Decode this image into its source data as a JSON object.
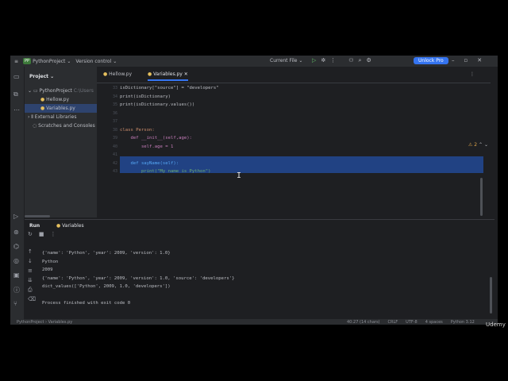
{
  "titlebar": {
    "project_name": "PythonProject",
    "project_badge": "PP",
    "vcs": "Version control",
    "run_config": "Current File",
    "unlock": "Unlock Pro"
  },
  "project_panel": {
    "header": "Project",
    "root": "PythonProject",
    "root_path": "C:\\Users",
    "files": [
      "Hellow.py",
      "Variables.py"
    ],
    "external": "External Libraries",
    "scratches": "Scratches and Consoles"
  },
  "editor": {
    "tabs": [
      "Hellow.py",
      "Variables.py"
    ],
    "warnings": "⚠ 2",
    "line_numbers": [
      "33",
      "34",
      "35",
      "36",
      "37",
      "38",
      "39",
      "40",
      "41",
      "42",
      "43"
    ],
    "lines": [
      "isDictionary[\"source\"] = \"developers\"",
      "print(isDictionary)",
      "print(isDictionary.values())",
      "",
      "",
      "class Person:",
      "    def __init__(self,age):",
      "        self.age = 1",
      "",
      "    def sayName(self):",
      "        print(\"My name is Python\")"
    ]
  },
  "run": {
    "header": "Run",
    "tab": "Variables",
    "output": [
      "{'name': 'Python', 'year': 2009, 'version': 1.0}",
      "Python",
      "2009",
      "{'name': 'Python', 'year': 2009, 'version': 1.0, 'source': 'developers'}",
      "dict_values(['Python', 2009, 1.0, 'developers'])",
      "",
      "Process finished with exit code 0"
    ]
  },
  "statusbar": {
    "breadcrumb": "PythonProject",
    "file": "Variables.py",
    "position": "40:27 (14 chars)",
    "line_sep": "CRLF",
    "encoding": "UTF-8",
    "indent": "4 spaces",
    "interpreter": "Python 3.12"
  },
  "watermark": "Udemy"
}
